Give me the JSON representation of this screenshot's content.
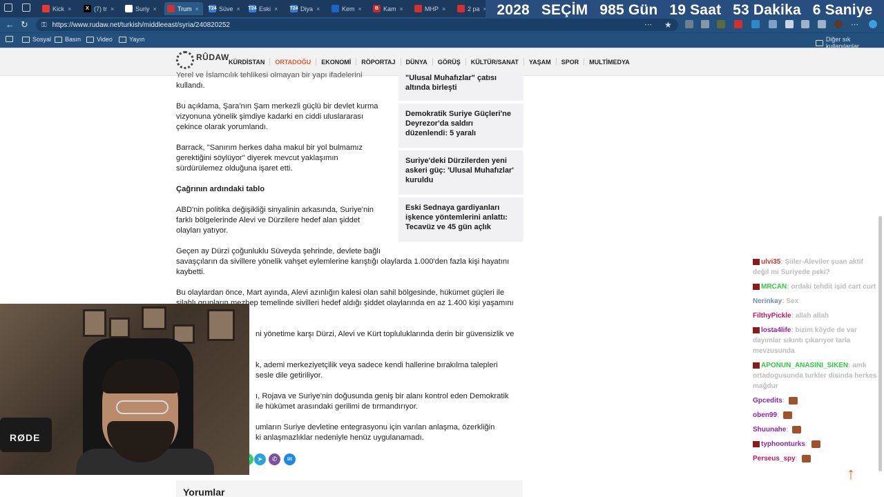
{
  "browser": {
    "tabs": [
      {
        "label": "Kick",
        "fav_color": "#e53935",
        "fav_text": ""
      },
      {
        "label": "(7) tr",
        "fav_color": "#000000",
        "fav_text": "X"
      },
      {
        "label": "Suriy",
        "fav_color": "#ffffff",
        "fav_text": ""
      },
      {
        "label": "Trum",
        "fav_color": "#cc3333",
        "fav_text": ""
      },
      {
        "label": "Süve",
        "fav_color": "#3a7bd5",
        "fav_text": "T24"
      },
      {
        "label": "Eski",
        "fav_color": "#3a7bd5",
        "fav_text": "T24"
      },
      {
        "label": "Diya",
        "fav_color": "#3a7bd5",
        "fav_text": "T24"
      },
      {
        "label": "Kem",
        "fav_color": "#1e63c8",
        "fav_text": ""
      },
      {
        "label": "Kam",
        "fav_color": "#c62828",
        "fav_text": "B"
      },
      {
        "label": "MHP",
        "fav_color": "#d32f2f",
        "fav_text": ""
      },
      {
        "label": "2 pa",
        "fav_color": "#d32f2f",
        "fav_text": ""
      }
    ],
    "url": "https://www.rudaw.net/turkish/middleeast/syria/240820252",
    "bookmarks": [
      "Sosyal",
      "Basın",
      "Video",
      "Yayın"
    ],
    "other_bookmarks": "Diğer sık kullanılanlar"
  },
  "countdown": {
    "year": "2028",
    "label": "SEÇİM",
    "days": "985 Gün",
    "hours": "19 Saat",
    "minutes": "53 Dakika",
    "seconds": "6 Saniye"
  },
  "site": {
    "logo": "RÛDAW",
    "nav": [
      "KÜRDİSTAN",
      "ORTADOĞU",
      "EKONOMİ",
      "RÖPORTAJ",
      "DÜNYA",
      "GÖRÜŞ",
      "KÜLTÜR/SANAT",
      "YAŞAM",
      "SPOR",
      "MULTİMEDYA"
    ],
    "active_nav": "ORTADOĞU"
  },
  "article": {
    "p0": "Yerel ve İslamcılık tehlikesi olmayan bir yapı ifadelerini",
    "p0b": "kullandı.",
    "p1": "Bu açıklama, Şara'nın Şam merkezli güçlü bir devlet kurma vizyonuna yönelik şimdiye kadarki en ciddi uluslararası çekince olarak yorumlandı.",
    "p2": "Barrack, \"Sanırım herkes daha makul bir yol bulmamız gerektiğini söylüyor\" diyerek mevcut yaklaşımın sürdürülemez olduğuna işaret etti.",
    "h1": "Çağrının ardındaki tablo",
    "p3": "ABD'nin politika değişikliği sinyalinin arkasında, Suriye'nin farklı bölgelerinde Alevi ve Dürzilere hedef alan şiddet olayları yatıyor.",
    "p4a": "Geçen ay Dürzi çoğunluklu Süveyda şehrinde, devlete bağlı",
    "p4b": "savaşçıların da sivillere yönelik vahşet eylemlerine karıştığı olaylarda 1.000'den fazla kişi hayatını kaybetti.",
    "p5a": "Bu olaylardan önce, Mart ayında, Alevi azınlığın kalesi olan sahil bölgesinde, hükümet güçleri ile",
    "p5b": "silahlı grupların mezhep temelinde sivilleri hedef aldığı şiddet olaylarında en az 1.400 kişi yaşamını",
    "p6": "ni yönetime karşı Dürzi, Alevi ve Kürt topluluklarında derin bir güvensizlik ve",
    "p7a": "k, ademi merkeziyetçilik veya sadece kendi hallerine bırakılma talepleri",
    "p7b": "sesle dile getiriliyor.",
    "p8a": "ı, Rojava ve Suriye'nin doğusunda geniş bir alanı kontrol eden Demokratik",
    "p8b": "ile hükümet arasındaki gerilimi de tırmandırıyor.",
    "p9a": "umların Suriye devletine entegrasyonu için varılan anlaşma, özerkliğin",
    "p9b": "ki anlaşmazlıklar nedeniyle henüz uygulanamadı."
  },
  "related": [
    "\"Ulusal Muhafızlar\" çatısı altında birleşti",
    "Demokratik Suriye Güçleri'ne Deyrezor'da saldırı düzenlendi: 5 yaralı",
    "Suriye'deki Dürzilerden yeni askeri güç: 'Ulusal Muhafızlar' kuruldu",
    "Eski Sednaya gardiyanları işkence yöntemlerini anlattı: Tecavüz ve 45 gün açlık"
  ],
  "comments_title": "Yorumlar",
  "webcam": {
    "mic_brand": "RØDE"
  },
  "chat": [
    {
      "user": "ulvi35",
      "user_color": "#c0392b",
      "badge": true,
      "text": "Şiiler-Aleviler şuan aktif değil mi Suriyede peki?"
    },
    {
      "user": "MRCAN",
      "user_color": "#2ecc40",
      "badge": true,
      "text": "ordaki tehdit işid cart curt"
    },
    {
      "user": "Nerinkay",
      "user_color": "#6f8fb3",
      "badge": false,
      "text": "Sex"
    },
    {
      "user": "FilthyPickle",
      "user_color": "#c2185b",
      "badge": false,
      "text": "allah allah"
    },
    {
      "user": "losta4life",
      "user_color": "#8e24aa",
      "badge": true,
      "text": "bizim köyde de var dayımlar sıkıntı çıkarıyor tarla mevzusunda"
    },
    {
      "user": "APONUN_ANASINI_SIKEN",
      "user_color": "#2ecc40",
      "badge": true,
      "text": "amk ortadogusunda turkler disinda herkes mağdur"
    },
    {
      "user": "Gpcedits",
      "user_color": "#8e24aa",
      "badge": false,
      "text": ""
    },
    {
      "user": "oben99",
      "user_color": "#8e24aa",
      "badge": false,
      "text": ""
    },
    {
      "user": "Shuunahe",
      "user_color": "#8e24aa",
      "badge": false,
      "text": ""
    },
    {
      "user": "typhoonturks",
      "user_color": "#8e24aa",
      "badge": true,
      "text": ""
    },
    {
      "user": "Perseus_spy",
      "user_color": "#c2185b",
      "badge": false,
      "text": ""
    }
  ]
}
